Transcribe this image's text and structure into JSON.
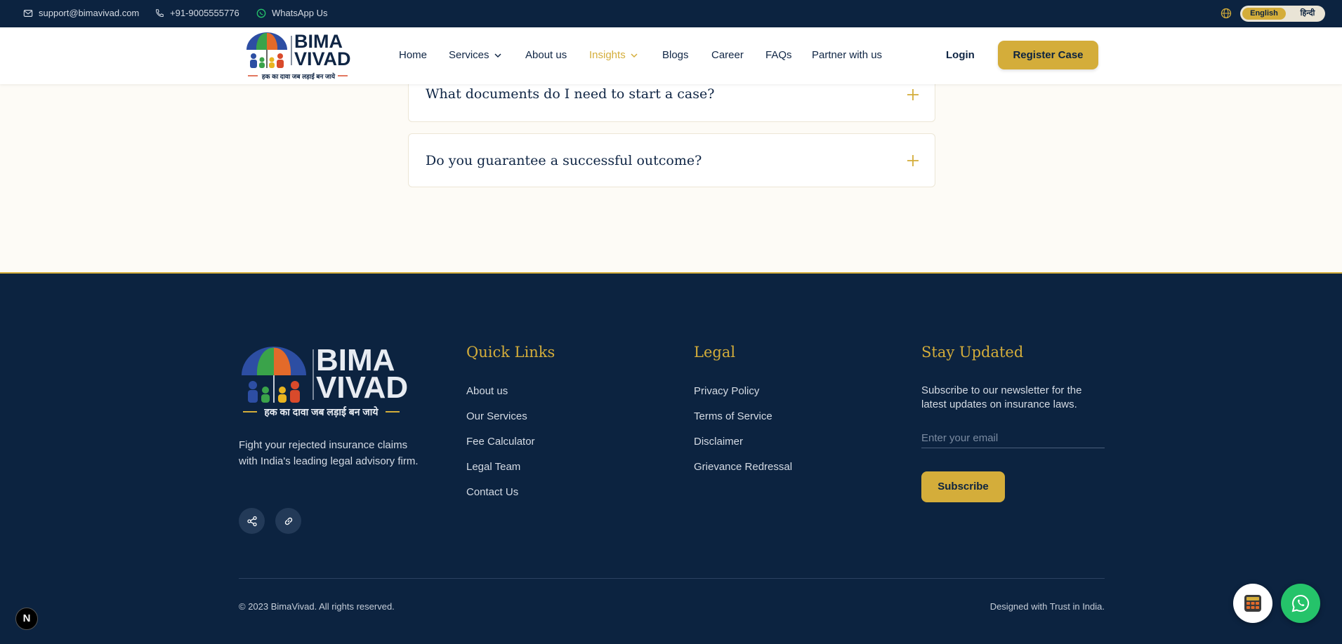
{
  "topbar": {
    "email": "support@bimavivad.com",
    "phone": "+91-9005555776",
    "whatsapp": "WhatsApp Us",
    "lang_en": "English",
    "lang_hi": "हिन्दी"
  },
  "logo": {
    "line1": "BIMA",
    "line2": "VIVAD",
    "tagline": "हक का दावा जब लड़ाई बन जाये"
  },
  "nav": {
    "items": [
      {
        "label": "Home"
      },
      {
        "label": "Services"
      },
      {
        "label": "About us"
      },
      {
        "label": "Insights"
      },
      {
        "label": "Blogs"
      },
      {
        "label": "Career"
      },
      {
        "label": "FAQs"
      },
      {
        "label": "Partner with us"
      }
    ],
    "login": "Login",
    "register": "Register Case"
  },
  "faq": {
    "items": [
      {
        "question": "What documents do I need to start a case?"
      },
      {
        "question": "Do you guarantee a successful outcome?"
      }
    ]
  },
  "footer": {
    "description": "Fight your rejected insurance claims with India's leading legal advisory firm.",
    "quick_links": {
      "heading": "Quick Links",
      "items": [
        "About us",
        "Our Services",
        "Fee Calculator",
        "Legal Team",
        "Contact Us"
      ]
    },
    "legal": {
      "heading": "Legal",
      "items": [
        "Privacy Policy",
        "Terms of Service",
        "Disclaimer",
        "Grievance Redressal"
      ]
    },
    "newsletter": {
      "heading": "Stay Updated",
      "text": "Subscribe to our newsletter for the latest updates on insurance laws.",
      "placeholder": "Enter your email",
      "button": "Subscribe"
    },
    "copyright": "© 2023 BimaVivad. All rights reserved.",
    "designed": "Designed with Trust in India."
  },
  "badge": "N",
  "colors": {
    "navy": "#0c2340",
    "gold": "#d4ad3a",
    "whatsapp_green": "#25c36a"
  }
}
